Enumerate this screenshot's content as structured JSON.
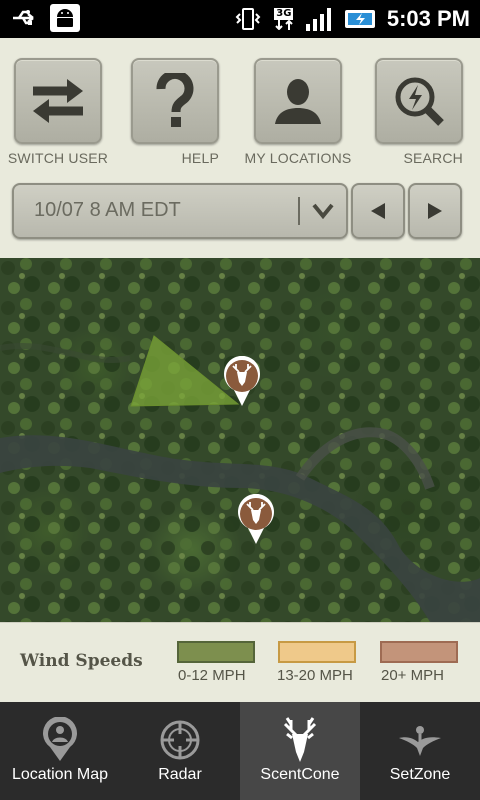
{
  "status_bar": {
    "time": "5:03 PM",
    "network": "3G",
    "icons": [
      "usb-icon",
      "android-debug-icon",
      "vibrate-icon",
      "network-3g-icon",
      "signal-icon",
      "battery-charging-icon"
    ]
  },
  "toolbar": {
    "buttons": [
      {
        "label": "SWITCH USER",
        "icon": "swap-arrows-icon"
      },
      {
        "label": "HELP",
        "icon": "question-mark-icon"
      },
      {
        "label": "MY LOCATIONS",
        "icon": "person-icon"
      },
      {
        "label": "SEARCH",
        "icon": "search-bolt-icon"
      }
    ],
    "time_selector": {
      "value": "10/07 8 AM EDT"
    }
  },
  "map": {
    "markers": [
      {
        "name": "deer-marker-1",
        "icon": "deer-head-icon"
      },
      {
        "name": "deer-marker-2",
        "icon": "deer-head-icon"
      }
    ],
    "scent_cone_color": "#7da83a"
  },
  "legend": {
    "title": "Wind Speeds",
    "items": [
      {
        "label": "0-12 MPH",
        "fill": "#7d8f4e",
        "border": "#55653a"
      },
      {
        "label": "13-20 MPH",
        "fill": "#efc98a",
        "border": "#c79a44"
      },
      {
        "label": "20+ MPH",
        "fill": "#c3947a",
        "border": "#9e6b53"
      }
    ]
  },
  "tabs": [
    {
      "label": "Location Map",
      "icon": "location-map-icon",
      "active": false
    },
    {
      "label": "Radar",
      "icon": "radar-crosshair-icon",
      "active": false
    },
    {
      "label": "ScentCone",
      "icon": "deer-head-icon",
      "active": true
    },
    {
      "label": "SetZone",
      "icon": "setzone-bird-icon",
      "active": false
    }
  ]
}
